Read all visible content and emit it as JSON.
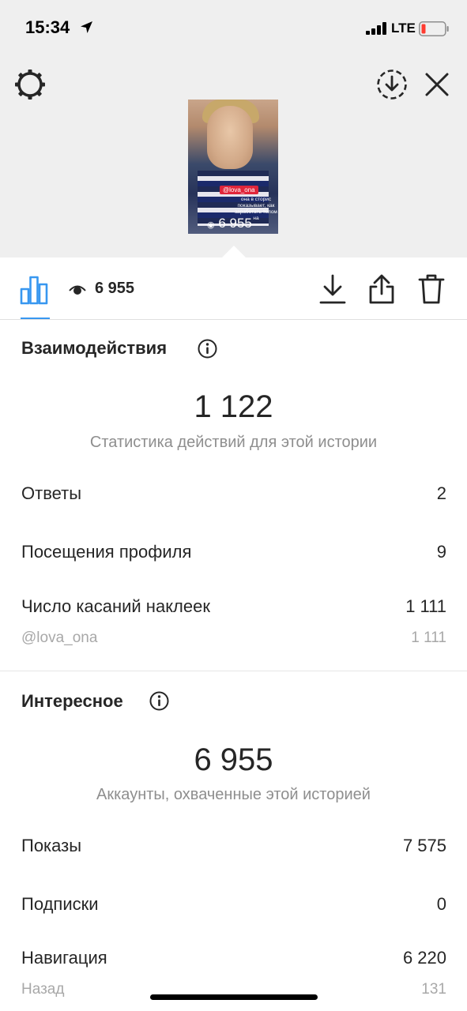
{
  "status_bar": {
    "time": "15:34",
    "network": "LTE"
  },
  "story_preview": {
    "tag": "@lova_ona",
    "caption": "она в сторис показывает, как заработать телом на",
    "views": "6 955"
  },
  "toolbar": {
    "views_count": "6 955"
  },
  "interactions": {
    "title": "Взаимодействия",
    "total": "1 122",
    "subtitle": "Статистика действий для этой истории",
    "rows": [
      {
        "label": "Ответы",
        "value": "2"
      },
      {
        "label": "Посещения профиля",
        "value": "9"
      },
      {
        "label": "Число касаний наклеек",
        "value": "1 111"
      }
    ],
    "sticker_row": {
      "label": "@lova_ona",
      "value": "1 111"
    }
  },
  "discovery": {
    "title": "Интересное",
    "total": "6 955",
    "subtitle": "Аккаунты, охваченные этой историей",
    "rows": [
      {
        "label": "Показы",
        "value": "7 575"
      },
      {
        "label": "Подписки",
        "value": "0"
      },
      {
        "label": "Навигация",
        "value": "6 220"
      }
    ],
    "back_row": {
      "label": "Назад",
      "value": "131"
    }
  },
  "colors": {
    "accent": "#3897f0",
    "text": "#262626",
    "muted": "#8e8e8e",
    "battery_low": "#ff3b30"
  },
  "icons": [
    "settings-gear-icon",
    "download-circle-icon",
    "close-icon",
    "insights-chart-icon",
    "eye-icon",
    "download-icon",
    "share-icon",
    "trash-icon",
    "info-icon"
  ]
}
